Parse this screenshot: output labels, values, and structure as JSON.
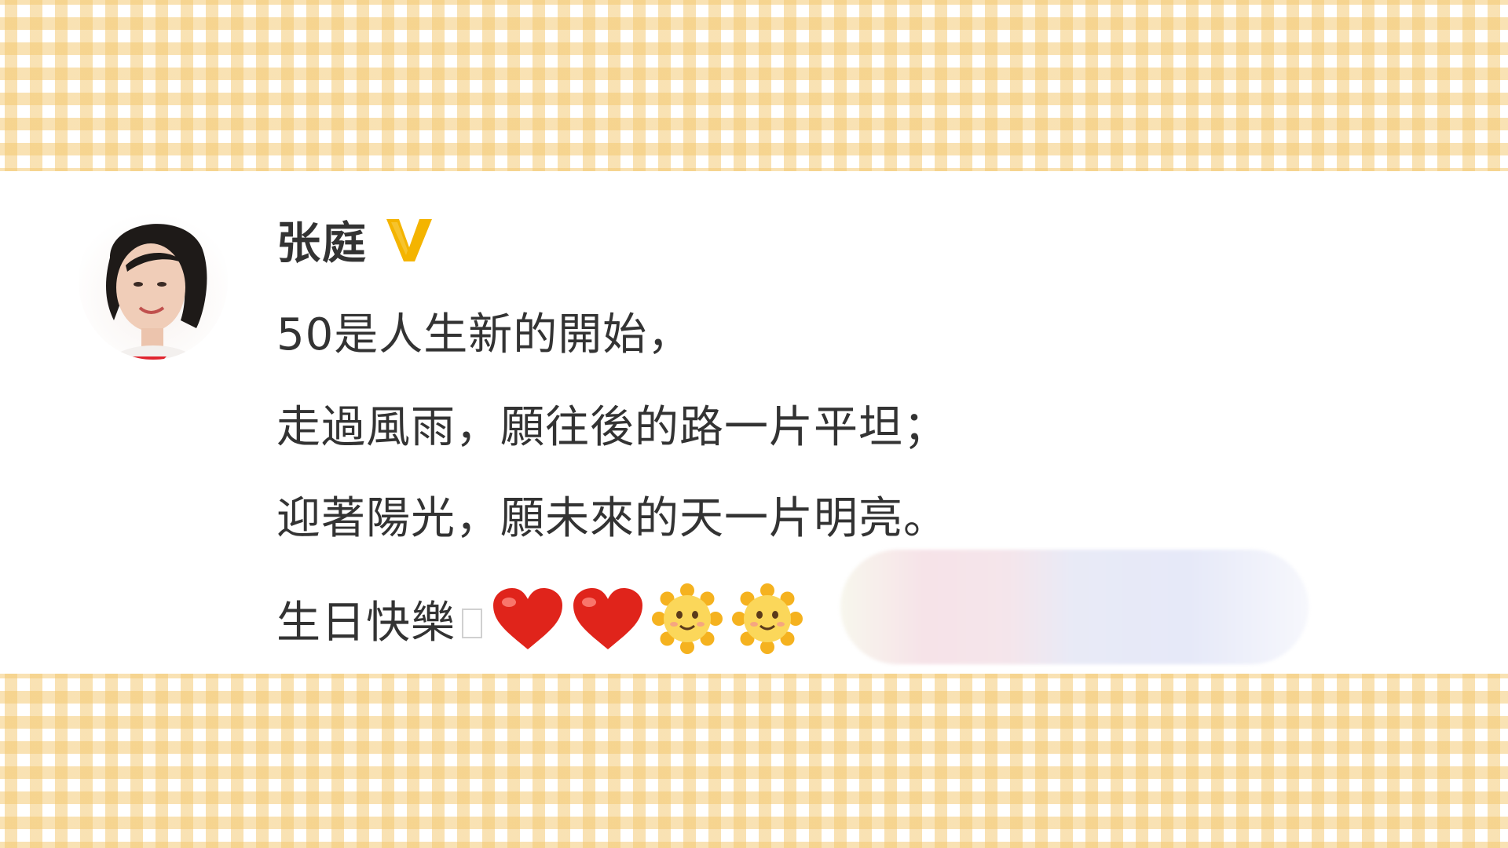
{
  "post": {
    "username": "张庭",
    "verified_badge": "V",
    "lines": [
      "50是人生新的開始，",
      "走過風雨，願往後的路一片平坦；",
      "迎著陽光，願未來的天一片明亮。",
      "生日快樂"
    ],
    "emojis": [
      "red-heart",
      "red-heart",
      "smiling-sun",
      "smiling-sun"
    ]
  },
  "colors": {
    "gingham": "#f3c86e",
    "verified": "#f4b400",
    "text": "#333333",
    "heart": "#e0241b",
    "sun": "#f5c23a"
  }
}
